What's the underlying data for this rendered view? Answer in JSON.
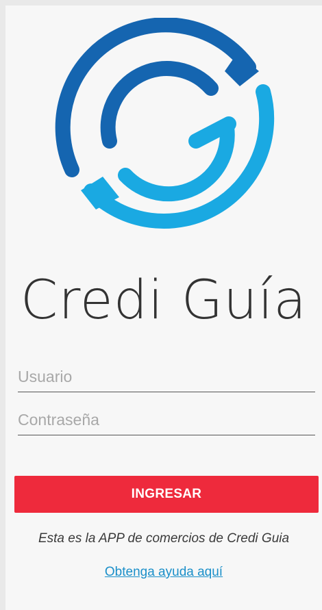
{
  "brand": {
    "name": "Credi Guía",
    "logo_icon": "credi-guia-logo-icon",
    "colors": {
      "dark_blue": "#1565b0",
      "light_blue": "#1aa9e2",
      "wordmark": "#333333"
    }
  },
  "login": {
    "username_placeholder": "Usuario",
    "password_placeholder": "Contraseña",
    "submit_label": "INGRESAR",
    "submit_color": "#ee2a3c"
  },
  "footer": {
    "tagline": "Esta es la APP de comercios de Credi Guia",
    "help_link": "Obtenga ayuda aquí",
    "link_color": "#1a8fc9"
  }
}
